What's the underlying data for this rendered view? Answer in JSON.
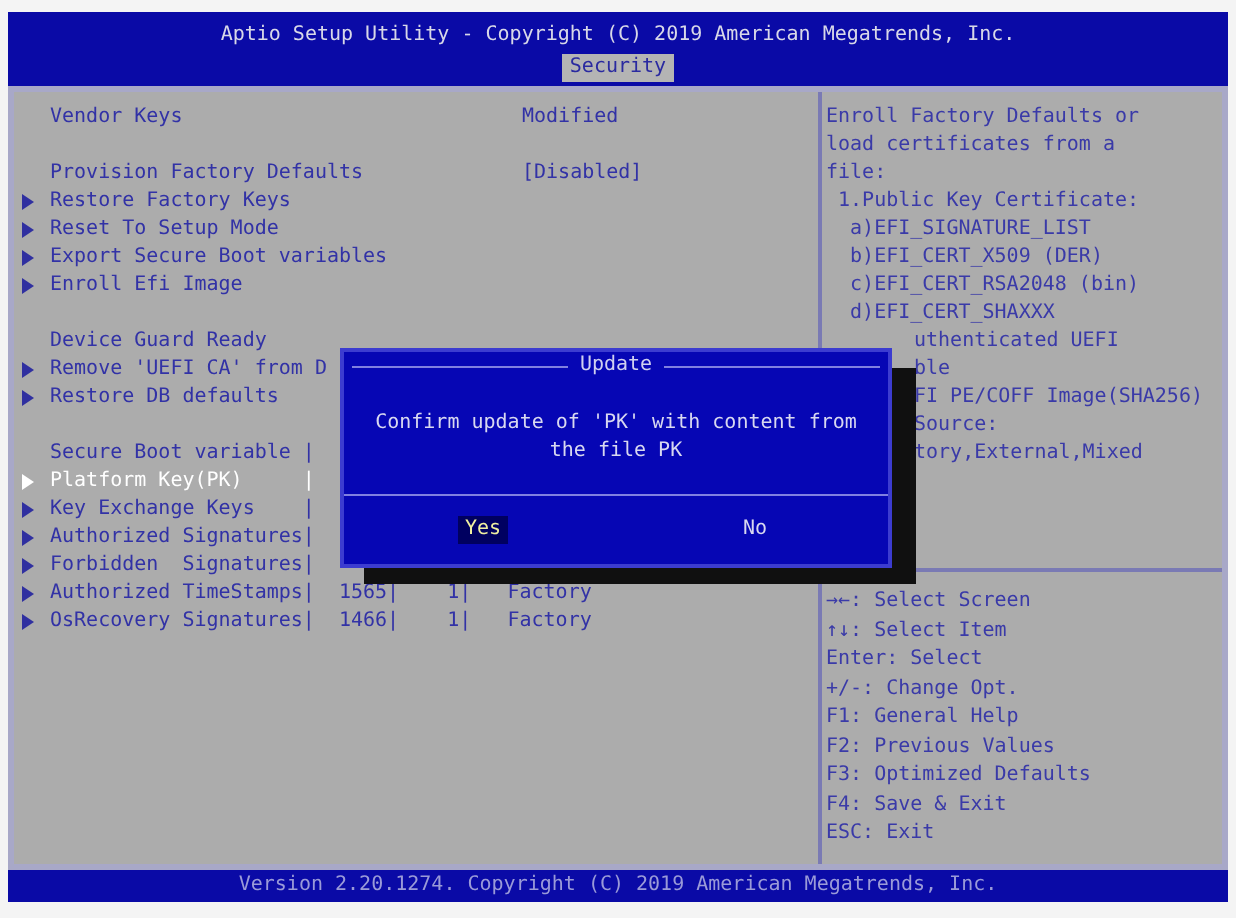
{
  "title": "Aptio Setup Utility - Copyright (C) 2019 American Megatrends, Inc.",
  "tabs": [
    {
      "label": "Security",
      "selected": true
    }
  ],
  "items": [
    {
      "kind": "info",
      "label": "Vendor Keys",
      "value": "Modified"
    },
    {
      "kind": "gap"
    },
    {
      "kind": "option",
      "label": "Provision Factory Defaults",
      "value": "[Disabled]"
    },
    {
      "kind": "submenu",
      "label": "Restore Factory Keys",
      "selected": false
    },
    {
      "kind": "submenu",
      "label": "Reset To Setup Mode",
      "selected": false
    },
    {
      "kind": "submenu",
      "label": "Export Secure Boot variables",
      "selected": false
    },
    {
      "kind": "submenu",
      "label": "Enroll Efi Image",
      "selected": false
    },
    {
      "kind": "gap"
    },
    {
      "kind": "info",
      "label": "Device Guard Ready"
    },
    {
      "kind": "submenu",
      "label": "Remove 'UEFI CA' from D",
      "selected": false
    },
    {
      "kind": "submenu",
      "label": "Restore DB defaults",
      "selected": false
    },
    {
      "kind": "gap"
    },
    {
      "kind": "table",
      "cells": [
        "Secure Boot variable",
        "|"
      ]
    },
    {
      "kind": "table-row",
      "selected": true,
      "cells": [
        "Platform Key(PK)",
        "|"
      ]
    },
    {
      "kind": "table-row",
      "selected": false,
      "cells": [
        "Key Exchange Keys",
        "|"
      ]
    },
    {
      "kind": "table-row",
      "selected": false,
      "cells": [
        "Authorized Signatures",
        "|"
      ]
    },
    {
      "kind": "table-row",
      "selected": false,
      "cells": [
        "Forbidden  Signatures",
        "|"
      ]
    },
    {
      "kind": "table-row",
      "selected": false,
      "cells": [
        "Authorized TimeStamps",
        "|",
        "1565|",
        "1|",
        "Factory"
      ]
    },
    {
      "kind": "table-row",
      "selected": false,
      "cells": [
        "OsRecovery Signatures",
        "|",
        "1466|",
        "1|",
        "Factory"
      ]
    }
  ],
  "help": [
    {
      "kind": "line",
      "text": "Enroll Factory Defaults or"
    },
    {
      "kind": "line",
      "text": "load certificates from a"
    },
    {
      "kind": "line",
      "text": "file:"
    },
    {
      "kind": "line",
      "text": " 1.Public Key Certificate:"
    },
    {
      "kind": "line",
      "text": "  a)EFI_SIGNATURE_LIST"
    },
    {
      "kind": "line",
      "text": "  b)EFI_CERT_X509 (DER)"
    },
    {
      "kind": "line",
      "text": "  c)EFI_CERT_RSA2048 (bin)"
    },
    {
      "kind": "line",
      "text": "  d)EFI_CERT_SHAXXX"
    },
    {
      "kind": "cut",
      "text": "uthenticated UEFI"
    },
    {
      "kind": "cut",
      "text": "ble"
    },
    {
      "kind": "cut",
      "text": "FI PE/COFF Image(SHA256)"
    },
    {
      "kind": "cut",
      "text": "Source:"
    },
    {
      "kind": "cut",
      "text": "tory,External,Mixed"
    }
  ],
  "keys": [
    "→←: Select Screen",
    "↑↓: Select Item",
    "Enter: Select",
    "+/-: Change Opt.",
    "F1: General Help",
    "F2: Previous Values",
    "F3: Optimized Defaults",
    "F4: Save & Exit",
    "ESC: Exit"
  ],
  "dialog": {
    "title": "Update",
    "message": "Confirm update of 'PK' with content from the file PK",
    "buttons": [
      {
        "label": "Yes",
        "selected": true
      },
      {
        "label": "No",
        "selected": false
      }
    ]
  },
  "footer": "Version 2.20.1274. Copyright (C) 2019 American Megatrends, Inc."
}
